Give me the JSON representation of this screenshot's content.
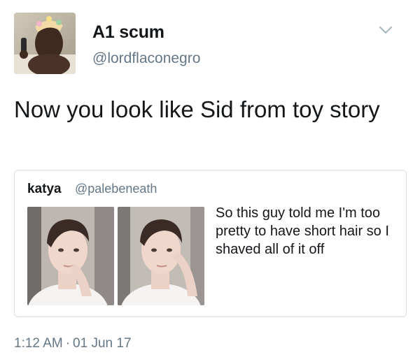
{
  "author": {
    "display_name": "A1 scum",
    "handle": "@lordflaconegro"
  },
  "tweet": {
    "text": "Now you look like Sid from toy story"
  },
  "quoted_tweet": {
    "display_name": "katya",
    "handle": "@palebeneath",
    "text": "So this guy told me I'm too pretty to have short hair so I shaved all of it off"
  },
  "meta": {
    "time": "1:12 AM",
    "separator": "·",
    "date": "01 Jun 17"
  },
  "icons": {
    "menu": "chevron-down-icon"
  },
  "colors": {
    "text": "#14171a",
    "secondary": "#657786",
    "border": "#dcdfe2"
  }
}
